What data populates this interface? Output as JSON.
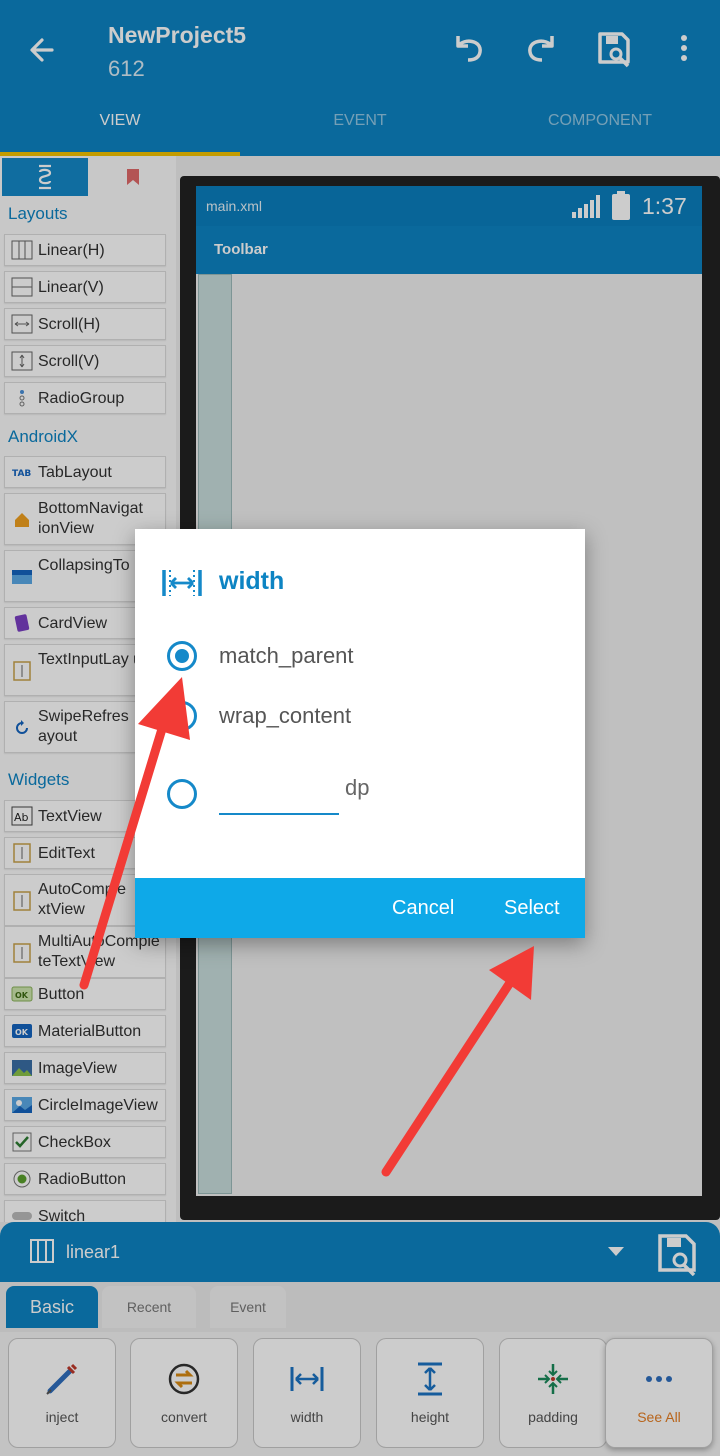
{
  "app": {
    "title": "NewProject5",
    "subtitle": "612"
  },
  "tabs": [
    {
      "label": "VIEW"
    },
    {
      "label": "EVENT"
    },
    {
      "label": "COMPONENT"
    }
  ],
  "palette": {
    "sections": {
      "layouts": "Layouts",
      "androidx": "AndroidX",
      "widgets": "Widgets"
    },
    "items": [
      {
        "label": "Linear(H)"
      },
      {
        "label": "Linear(V)"
      },
      {
        "label": "Scroll(H)"
      },
      {
        "label": "Scroll(V)"
      },
      {
        "label": "RadioGroup"
      },
      {
        "label": "TabLayout"
      },
      {
        "label": "BottomNavigat ionView"
      },
      {
        "label": "CollapsingTo bar"
      },
      {
        "label": "CardView"
      },
      {
        "label": "TextInputLay ut"
      },
      {
        "label": "SwipeRefres ayout"
      },
      {
        "label": "TextView"
      },
      {
        "label": "EditText"
      },
      {
        "label": "AutoComple xtView"
      },
      {
        "label": "MultiAutoComple teTextView"
      },
      {
        "label": "Button"
      },
      {
        "label": "MaterialButton"
      },
      {
        "label": "ImageView"
      },
      {
        "label": "CircleImageView"
      },
      {
        "label": "CheckBox"
      },
      {
        "label": "RadioButton"
      },
      {
        "label": "Switch"
      }
    ]
  },
  "device": {
    "file": "main.xml",
    "time": "1:37",
    "toolbar": "Toolbar"
  },
  "property_bar": {
    "selected": "linear1",
    "tabs": [
      {
        "label": "Basic"
      },
      {
        "label": "Recent"
      },
      {
        "label": "Event"
      }
    ],
    "buttons": [
      {
        "label": "inject",
        "icon": "syringe-icon"
      },
      {
        "label": "convert",
        "icon": "convert-icon"
      },
      {
        "label": "width",
        "icon": "width-icon"
      },
      {
        "label": "height",
        "icon": "height-icon"
      },
      {
        "label": "padding",
        "icon": "padding-icon"
      },
      {
        "label": "See All",
        "icon": "more-dots-icon"
      }
    ]
  },
  "dialog": {
    "title": "width",
    "options": [
      {
        "label": "match_parent",
        "checked": true
      },
      {
        "label": "wrap_content",
        "checked": false
      }
    ],
    "custom_value": "",
    "unit": "dp",
    "cancel": "Cancel",
    "select": "Select"
  },
  "colors": {
    "primary": "#0d84c3",
    "accent": "#f6c400",
    "dialog_actions": "#0ea9e8",
    "annotation": "#f23b36"
  }
}
